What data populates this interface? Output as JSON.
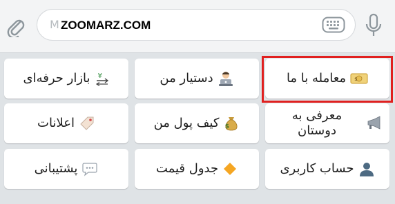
{
  "composer": {
    "placeholder": "M",
    "watermark": "ZOOMARZ.COM"
  },
  "keyboard": {
    "rows": [
      [
        {
          "label": "بازار حرفه‌ای",
          "icon": "currency-exchange-icon"
        },
        {
          "label": "دستیار من",
          "icon": "technologist-icon"
        },
        {
          "label": "معامله با ما",
          "icon": "banknote-icon",
          "highlighted": true
        }
      ],
      [
        {
          "label": "اعلانات",
          "icon": "tag-icon"
        },
        {
          "label": "کیف پول من",
          "icon": "money-bag-icon"
        },
        {
          "label": "معرفی به دوستان",
          "icon": "megaphone-icon"
        }
      ],
      [
        {
          "label": "پشتیبانی",
          "icon": "speech-bubble-icon"
        },
        {
          "label": "جدول قیمت",
          "icon": "orange-diamond-icon"
        },
        {
          "label": "حساب کاربری",
          "icon": "user-silhouette-icon"
        }
      ]
    ]
  },
  "colors": {
    "highlight": "#e0201f",
    "background": "#dfe3e6"
  }
}
